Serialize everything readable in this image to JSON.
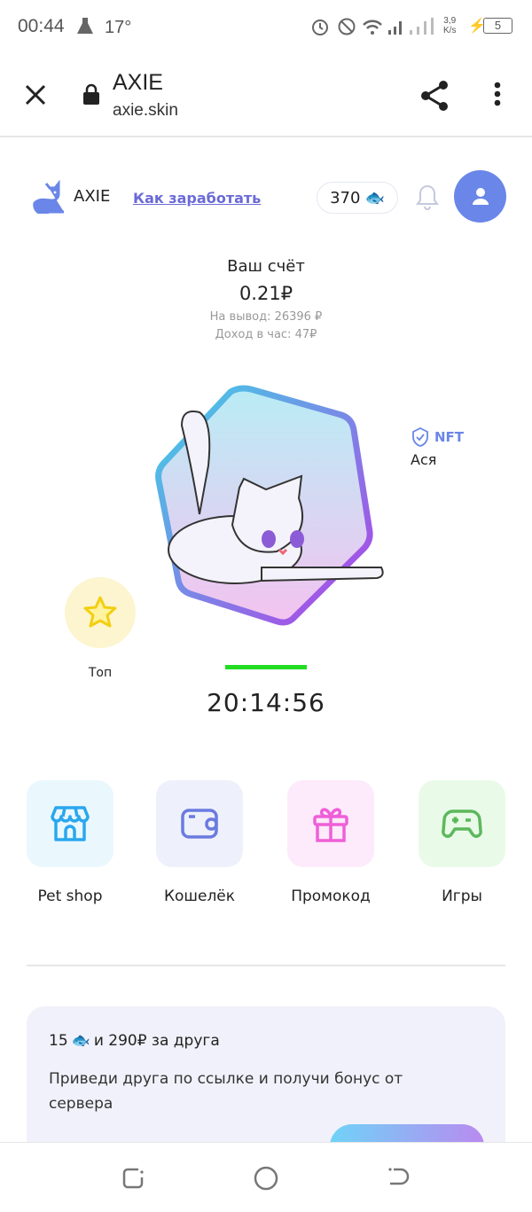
{
  "status_bar": {
    "time": "00:44",
    "temperature": "17°",
    "net_speed_value": "3,9",
    "net_speed_unit": "K/s",
    "battery": "5"
  },
  "browser": {
    "title": "AXIE",
    "url": "axie.skin"
  },
  "header": {
    "logo": "AXIE",
    "earn_link": "Как заработать",
    "fish_count": "370"
  },
  "account": {
    "label": "Ваш счёт",
    "balance": "0.21₽",
    "withdraw": "На вывод: 26396 ₽",
    "income": "Доход в час: 47₽"
  },
  "pet": {
    "nft_label": "NFT",
    "name": "Ася",
    "timer": "20:14:56",
    "progress": 1.0
  },
  "top": {
    "label": "Топ"
  },
  "tiles": [
    {
      "label": "Pet shop",
      "icon": "store-icon",
      "color": "#2aa7ee",
      "bg": "#eaf8fe"
    },
    {
      "label": "Кошелёк",
      "icon": "wallet-icon",
      "color": "#6a7ae0",
      "bg": "#eef0fb"
    },
    {
      "label": "Промокод",
      "icon": "gift-icon",
      "color": "#ef5fd8",
      "bg": "#fdeafb"
    },
    {
      "label": "Игры",
      "icon": "gamepad-icon",
      "color": "#5cb85c",
      "bg": "#e9fbe8"
    }
  ],
  "referral": {
    "count": "15",
    "title_rest": "и 290₽ за друга",
    "text": "Приведи друга по ссылке и получи бонус от сервера"
  },
  "colors": {
    "accent": "#6a86e8",
    "link": "#6b6ad6",
    "progress": "#22dd22"
  }
}
